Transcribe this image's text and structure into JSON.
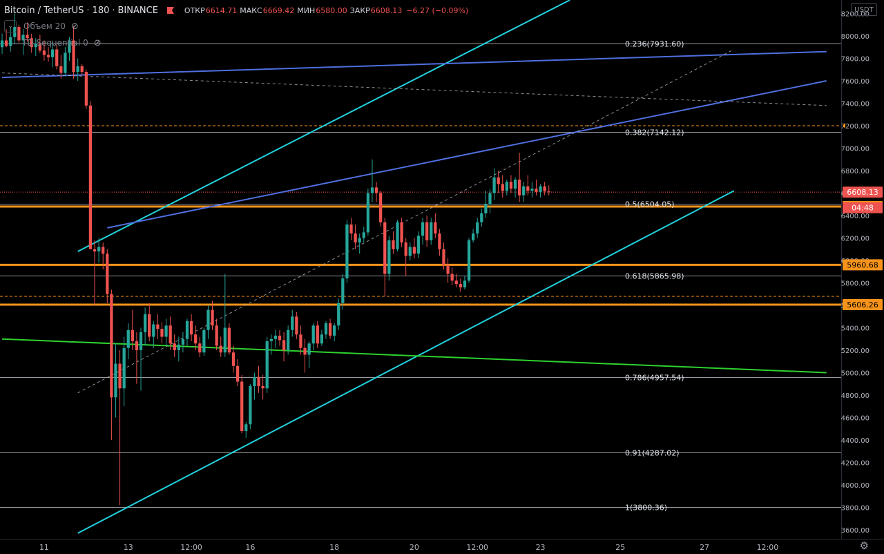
{
  "header": {
    "symbol": "Bitcoin / TetherUS",
    "interval": "180",
    "exchange": "BINANCE",
    "open_label": "ОТКР",
    "open_value": "6614.71",
    "high_label": "МАКС",
    "high_value": "6669.42",
    "low_label": "МИН",
    "low_value": "6580.00",
    "close_label": "ЗАКР",
    "close_value": "6608.13",
    "change": "−6.27 (−0.09%)",
    "flag_color": "#ef5350"
  },
  "indicators": [
    {
      "name": "Объем 20",
      "icon": "eye-off-icon"
    },
    {
      "name": "TD Sequential 0",
      "icon": "eye-off-icon"
    }
  ],
  "currency_badge": "USDT",
  "settings_icon": "gear-icon",
  "colors": {
    "background": "#000000",
    "up": "#26a69a",
    "down": "#ef5350",
    "channel": "#22d3de",
    "blue_line": "#4f6fe0",
    "green_line": "#2ed12e",
    "orange": "#f7931a",
    "fib": "#b2b5be",
    "axis_text": "#b2b5be"
  },
  "chart_data": {
    "type": "candlestick",
    "title": "Bitcoin / TetherUS · 180 · BINANCE",
    "ylim": [
      3520,
      8320
    ],
    "y_ticks": [
      3600,
      3800,
      4000,
      4200,
      4400,
      4600,
      4800,
      5000,
      5200,
      5400,
      5600,
      5800,
      6000,
      6200,
      6400,
      6600,
      6800,
      7000,
      7200,
      7400,
      7600,
      7800,
      8000,
      8200
    ],
    "x_ticks": [
      "11",
      "13",
      "12:00",
      "16",
      "18",
      "20",
      "12:00",
      "23",
      "25",
      "27",
      "12:00"
    ],
    "bar_domain": [
      0,
      200
    ],
    "x_tick_bars": [
      10,
      30,
      45,
      59,
      79,
      98,
      113,
      128,
      147,
      167,
      182
    ],
    "grid": false,
    "fib_levels": [
      {
        "label": "0.236(7931.60)",
        "value": 7931.6
      },
      {
        "label": "0.382(7142.12)",
        "value": 7142.12
      },
      {
        "label": "0.5(6504.05)",
        "value": 6504.05
      },
      {
        "label": "0.618(5865.98)",
        "value": 5865.98
      },
      {
        "label": "0.786(4957.54)",
        "value": 4957.54
      },
      {
        "label": "0.91(4287.02)",
        "value": 4287.02
      },
      {
        "label": "1(3800.36)",
        "value": 3800.36
      }
    ],
    "horizontal_levels": [
      {
        "value": 6479.67,
        "label": "6479.67"
      },
      {
        "value": 5960.68,
        "label": "5960.68"
      },
      {
        "value": 5606.26,
        "label": "5606.26"
      }
    ],
    "dashed_levels": [
      {
        "value": 7200
      },
      {
        "value": 5680
      }
    ],
    "price_tags": [
      {
        "value": 6608.13,
        "label": "6608.13",
        "kind": "last"
      },
      {
        "value": 6470,
        "label": "04:48",
        "kind": "timer"
      }
    ],
    "trendlines": [
      {
        "name": "",
        "color": "channel",
        "from": [
          18,
          6080
        ],
        "to": [
          135,
          8320
        ]
      },
      {
        "name": "",
        "color": "channel",
        "from": [
          18,
          3570
        ],
        "to": [
          174,
          6620
        ]
      },
      {
        "name": "",
        "color": "blue_line",
        "from": [
          25,
          6290
        ],
        "to": [
          196,
          7600
        ]
      },
      {
        "name": "",
        "color": "blue_line",
        "from": [
          0,
          7630
        ],
        "to": [
          196,
          7860
        ]
      },
      {
        "name": "",
        "color": "green_line",
        "from": [
          0,
          5300
        ],
        "to": [
          196,
          5000
        ]
      }
    ],
    "dashed_trendlines": [
      {
        "from": [
          18,
          4820
        ],
        "to": [
          174,
          7880
        ]
      },
      {
        "from": [
          0,
          7670
        ],
        "to": [
          196,
          7380
        ]
      }
    ],
    "candles": [
      [
        7900,
        8020,
        7840,
        7960
      ],
      [
        7960,
        8060,
        7900,
        7910
      ],
      [
        7910,
        8080,
        7860,
        7990
      ],
      [
        7990,
        8200,
        7930,
        8080
      ],
      [
        8080,
        8100,
        7940,
        7960
      ],
      [
        7960,
        8060,
        7830,
        8010
      ],
      [
        8010,
        8120,
        7950,
        7980
      ],
      [
        7980,
        8020,
        7850,
        7900
      ],
      [
        7900,
        7980,
        7820,
        7930
      ],
      [
        7930,
        8010,
        7850,
        7870
      ],
      [
        7870,
        7960,
        7780,
        7830
      ],
      [
        7830,
        7900,
        7770,
        7810
      ],
      [
        7810,
        7950,
        7720,
        7880
      ],
      [
        7880,
        7920,
        7700,
        7730
      ],
      [
        7730,
        7830,
        7620,
        7670
      ],
      [
        7670,
        7900,
        7640,
        7850
      ],
      [
        7850,
        7990,
        7780,
        7960
      ],
      [
        7960,
        8090,
        7620,
        7680
      ],
      [
        7680,
        7800,
        7600,
        7730
      ],
      [
        7730,
        7750,
        7650,
        7680
      ],
      [
        7680,
        7700,
        7350,
        7380
      ],
      [
        7380,
        7420,
        6100,
        6100
      ],
      [
        6100,
        6180,
        5600,
        6080
      ],
      [
        6080,
        6200,
        5980,
        6120
      ],
      [
        6120,
        6160,
        5920,
        6060
      ],
      [
        6060,
        6100,
        5620,
        5700
      ],
      [
        5700,
        5740,
        4400,
        4780
      ],
      [
        4780,
        5260,
        4600,
        5080
      ],
      [
        5080,
        5200,
        3820,
        4860
      ],
      [
        4860,
        5320,
        4700,
        5220
      ],
      [
        5220,
        5440,
        5120,
        5380
      ],
      [
        5380,
        5560,
        5200,
        5280
      ],
      [
        5280,
        5360,
        4900,
        5200
      ],
      [
        5200,
        5400,
        4840,
        5360
      ],
      [
        5360,
        5580,
        5240,
        5520
      ],
      [
        5520,
        5620,
        5280,
        5320
      ],
      [
        5320,
        5460,
        5220,
        5430
      ],
      [
        5430,
        5520,
        5300,
        5390
      ],
      [
        5390,
        5450,
        5260,
        5320
      ],
      [
        5320,
        5480,
        5240,
        5420
      ],
      [
        5420,
        5500,
        5200,
        5260
      ],
      [
        5260,
        5340,
        5140,
        5200
      ],
      [
        5200,
        5320,
        5100,
        5250
      ],
      [
        5250,
        5360,
        5180,
        5300
      ],
      [
        5300,
        5480,
        5240,
        5460
      ],
      [
        5460,
        5520,
        5280,
        5340
      ],
      [
        5340,
        5420,
        5200,
        5260
      ],
      [
        5260,
        5320,
        5140,
        5180
      ],
      [
        5180,
        5400,
        5150,
        5380
      ],
      [
        5380,
        5600,
        5300,
        5560
      ],
      [
        5560,
        5640,
        5380,
        5420
      ],
      [
        5420,
        5480,
        5200,
        5240
      ],
      [
        5240,
        5320,
        5140,
        5180
      ],
      [
        5180,
        5880,
        5140,
        5400
      ],
      [
        5400,
        5440,
        5160,
        5180
      ],
      [
        5180,
        5240,
        5000,
        5060
      ],
      [
        5060,
        5120,
        4880,
        4920
      ],
      [
        4920,
        4980,
        4460,
        4480
      ],
      [
        4480,
        4560,
        4420,
        4540
      ],
      [
        4540,
        4900,
        4500,
        4880
      ],
      [
        4880,
        5000,
        4760,
        4960
      ],
      [
        4960,
        5060,
        4820,
        4880
      ],
      [
        4880,
        4980,
        4760,
        4860
      ],
      [
        4860,
        5320,
        4820,
        5280
      ],
      [
        5280,
        5340,
        5160,
        5300
      ],
      [
        5300,
        5380,
        5220,
        5330
      ],
      [
        5330,
        5380,
        5240,
        5290
      ],
      [
        5290,
        5360,
        5100,
        5200
      ],
      [
        5200,
        5420,
        5160,
        5380
      ],
      [
        5380,
        5560,
        5320,
        5500
      ],
      [
        5500,
        5540,
        5300,
        5340
      ],
      [
        5340,
        5420,
        5160,
        5220
      ],
      [
        5220,
        5300,
        5000,
        5160
      ],
      [
        5160,
        5280,
        5040,
        5260
      ],
      [
        5260,
        5440,
        5200,
        5420
      ],
      [
        5420,
        5460,
        5220,
        5260
      ],
      [
        5260,
        5380,
        5240,
        5340
      ],
      [
        5340,
        5460,
        5300,
        5440
      ],
      [
        5440,
        5480,
        5300,
        5330
      ],
      [
        5330,
        5440,
        5280,
        5420
      ],
      [
        5420,
        5660,
        5380,
        5620
      ],
      [
        5620,
        5880,
        5560,
        5840
      ],
      [
        5840,
        6360,
        5800,
        6320
      ],
      [
        6320,
        6380,
        6180,
        6240
      ],
      [
        6240,
        6320,
        6100,
        6160
      ],
      [
        6160,
        6240,
        6060,
        6200
      ],
      [
        6200,
        6300,
        6160,
        6250
      ],
      [
        6250,
        6640,
        6220,
        6600
      ],
      [
        6600,
        6900,
        6520,
        6650
      ],
      [
        6650,
        6700,
        6520,
        6600
      ],
      [
        6600,
        6620,
        6300,
        6340
      ],
      [
        6340,
        6380,
        5680,
        5880
      ],
      [
        5880,
        6220,
        5820,
        6180
      ],
      [
        6180,
        6260,
        6060,
        6100
      ],
      [
        6100,
        6360,
        6080,
        6340
      ],
      [
        6340,
        6380,
        6120,
        6160
      ],
      [
        6160,
        6200,
        5860,
        6040
      ],
      [
        6040,
        6160,
        6000,
        6120
      ],
      [
        6120,
        6200,
        6020,
        6060
      ],
      [
        6060,
        6260,
        6020,
        6220
      ],
      [
        6220,
        6380,
        6140,
        6340
      ],
      [
        6340,
        6400,
        6120,
        6180
      ],
      [
        6180,
        6380,
        6140,
        6340
      ],
      [
        6340,
        6420,
        6200,
        6240
      ],
      [
        6240,
        6280,
        6040,
        6100
      ],
      [
        6100,
        6160,
        5920,
        5960
      ],
      [
        5960,
        6020,
        5800,
        5880
      ],
      [
        5880,
        5940,
        5780,
        5820
      ],
      [
        5820,
        5880,
        5760,
        5790
      ],
      [
        5790,
        5840,
        5720,
        5760
      ],
      [
        5760,
        5860,
        5740,
        5820
      ],
      [
        5820,
        6200,
        5800,
        6180
      ],
      [
        6180,
        6280,
        6160,
        6240
      ],
      [
        6240,
        6380,
        6200,
        6340
      ],
      [
        6340,
        6460,
        6300,
        6420
      ],
      [
        6420,
        6620,
        6380,
        6500
      ],
      [
        6500,
        6640,
        6420,
        6600
      ],
      [
        6600,
        6820,
        6540,
        6740
      ],
      [
        6740,
        6800,
        6600,
        6680
      ],
      [
        6680,
        6760,
        6560,
        6620
      ],
      [
        6620,
        6720,
        6580,
        6700
      ],
      [
        6700,
        6760,
        6600,
        6640
      ],
      [
        6640,
        6740,
        6560,
        6720
      ],
      [
        6720,
        6960,
        6520,
        6580
      ],
      [
        6580,
        6700,
        6520,
        6660
      ],
      [
        6660,
        6760,
        6580,
        6620
      ],
      [
        6620,
        6700,
        6560,
        6640
      ],
      [
        6640,
        6720,
        6580,
        6610
      ],
      [
        6610,
        6680,
        6560,
        6660
      ],
      [
        6660,
        6700,
        6580,
        6615
      ],
      [
        6615,
        6669,
        6580,
        6608
      ]
    ]
  }
}
